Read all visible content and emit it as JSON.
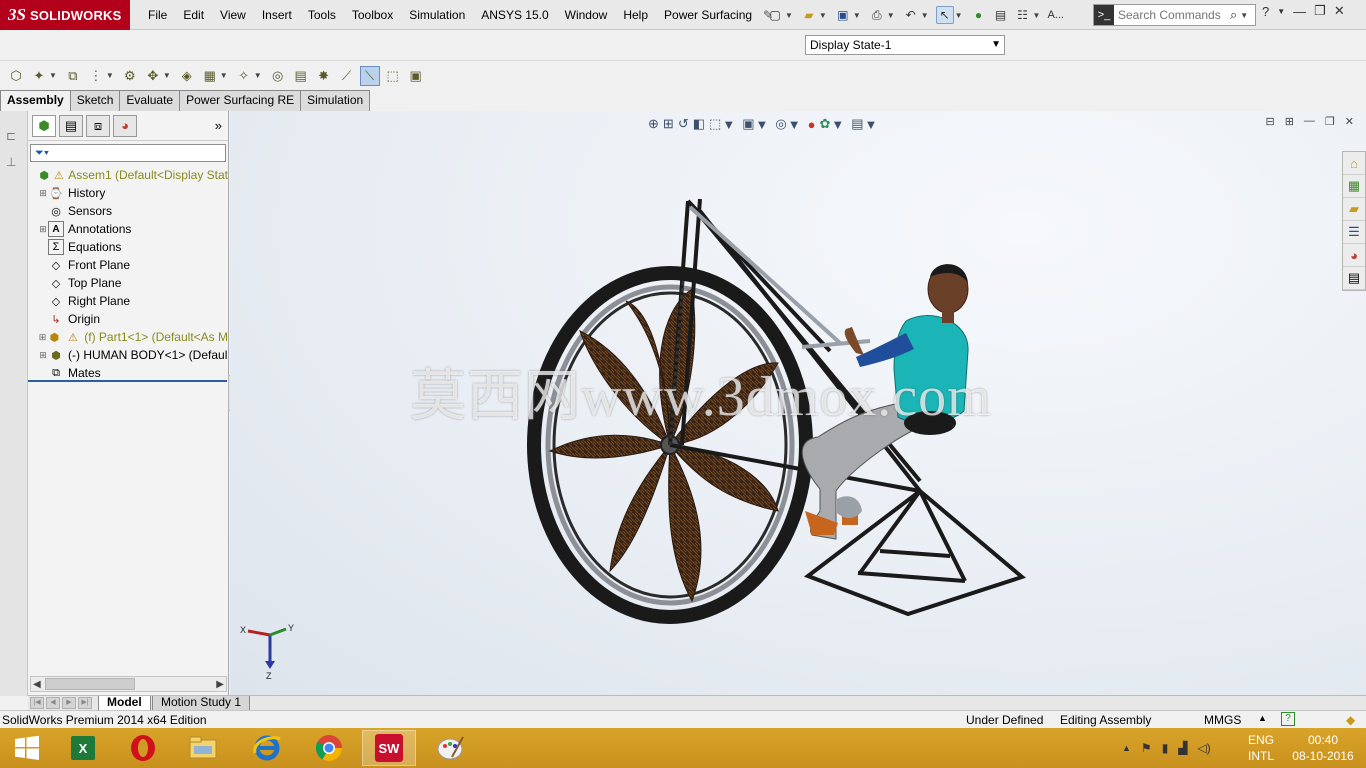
{
  "app": {
    "brand_ds": "3S",
    "brand_name": "SOLIDWORKS"
  },
  "menu": [
    "File",
    "Edit",
    "View",
    "Insert",
    "Tools",
    "Toolbox",
    "Simulation",
    "ANSYS 15.0",
    "Window",
    "Help",
    "Power Surfacing"
  ],
  "quickbar": {
    "overflow_label": "A..."
  },
  "search": {
    "placeholder": "Search Commands"
  },
  "display_state": {
    "value": "Display State-1"
  },
  "command_tabs": [
    "Assembly",
    "Sketch",
    "Evaluate",
    "Power Surfacing RE",
    "Simulation"
  ],
  "feature_tree": {
    "root": "Assem1  (Default<Display Stat",
    "items": [
      {
        "label": "History",
        "icon": "history-icon"
      },
      {
        "label": "Sensors",
        "icon": "sensor-icon"
      },
      {
        "label": "Annotations",
        "icon": "annotation-icon"
      },
      {
        "label": "Equations",
        "icon": "sigma-icon"
      },
      {
        "label": "Front Plane",
        "icon": "plane-icon"
      },
      {
        "label": "Top Plane",
        "icon": "plane-icon"
      },
      {
        "label": "Right Plane",
        "icon": "plane-icon"
      },
      {
        "label": "Origin",
        "icon": "origin-icon"
      },
      {
        "label": "(f) Part1<1> (Default<As M",
        "icon": "part-icon"
      },
      {
        "label": "(-) HUMAN BODY<1> (Defaul",
        "icon": "part-icon"
      },
      {
        "label": "Mates",
        "icon": "mates-icon"
      }
    ]
  },
  "viewport": {
    "watermark": "莫西网www.3dmox.com",
    "triad": {
      "x": "X",
      "y": "Y",
      "z": "Z"
    }
  },
  "bottom_tabs": [
    "Model",
    "Motion Study 1"
  ],
  "status": {
    "edition": "SolidWorks Premium 2014 x64 Edition",
    "definition": "Under Defined",
    "mode": "Editing Assembly",
    "units": "MMGS"
  },
  "taskbar": {
    "apps": [
      "start-icon",
      "excel-icon",
      "opera-icon",
      "file-explorer-icon",
      "internet-explorer-icon",
      "chrome-icon",
      "solidworks-icon",
      "paint-icon"
    ],
    "lang_top": "ENG",
    "lang_bottom": "INTL",
    "time": "00:40",
    "date": "08-10-2016"
  },
  "colors": {
    "brand": "#b3001b",
    "taskbar": "#d09a24",
    "accent": "#2a5ea8",
    "shirt": "#1bb5b8"
  }
}
